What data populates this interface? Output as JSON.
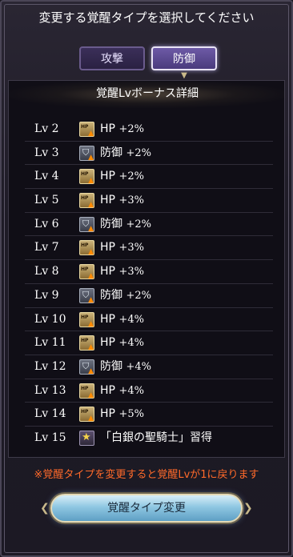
{
  "header": {
    "title": "変更する覚醒タイプを選択してください"
  },
  "tabs": [
    {
      "label": "攻撃",
      "selected": false
    },
    {
      "label": "防御",
      "selected": true
    }
  ],
  "section_title": "覚醒Lvボーナス詳細",
  "levels": [
    {
      "level": "Lv 2",
      "icon": "hp-up-icon",
      "stat": "HP",
      "value": "+2%"
    },
    {
      "level": "Lv 3",
      "icon": "defense-up-icon",
      "stat": "防御",
      "value": "+2%"
    },
    {
      "level": "Lv 4",
      "icon": "hp-up-icon",
      "stat": "HP",
      "value": "+2%"
    },
    {
      "level": "Lv 5",
      "icon": "hp-up-icon",
      "stat": "HP",
      "value": "+3%"
    },
    {
      "level": "Lv 6",
      "icon": "defense-up-icon",
      "stat": "防御",
      "value": "+2%"
    },
    {
      "level": "Lv 7",
      "icon": "hp-up-icon",
      "stat": "HP",
      "value": "+3%"
    },
    {
      "level": "Lv 8",
      "icon": "hp-up-icon",
      "stat": "HP",
      "value": "+3%"
    },
    {
      "level": "Lv 9",
      "icon": "defense-up-icon",
      "stat": "防御",
      "value": "+2%"
    },
    {
      "level": "Lv 10",
      "icon": "hp-up-icon",
      "stat": "HP",
      "value": "+4%"
    },
    {
      "level": "Lv 11",
      "icon": "hp-up-icon",
      "stat": "HP",
      "value": "+4%"
    },
    {
      "level": "Lv 12",
      "icon": "defense-up-icon",
      "stat": "防御",
      "value": "+4%"
    },
    {
      "level": "Lv 13",
      "icon": "hp-up-icon",
      "stat": "HP",
      "value": "+4%"
    },
    {
      "level": "Lv 14",
      "icon": "hp-up-icon",
      "stat": "HP",
      "value": "+5%"
    },
    {
      "level": "Lv 15",
      "icon": "star-skill-icon",
      "stat": "「白銀の聖騎士」習得",
      "value": ""
    }
  ],
  "note": "※覚醒タイプを変更すると覚醒Lvが1に戻ります",
  "change_button": {
    "label": "覚醒タイプ変更"
  },
  "colors": {
    "note": "#ff6a2a",
    "selected_tab": "#6d5aa6",
    "button": "#8fc7e2"
  }
}
